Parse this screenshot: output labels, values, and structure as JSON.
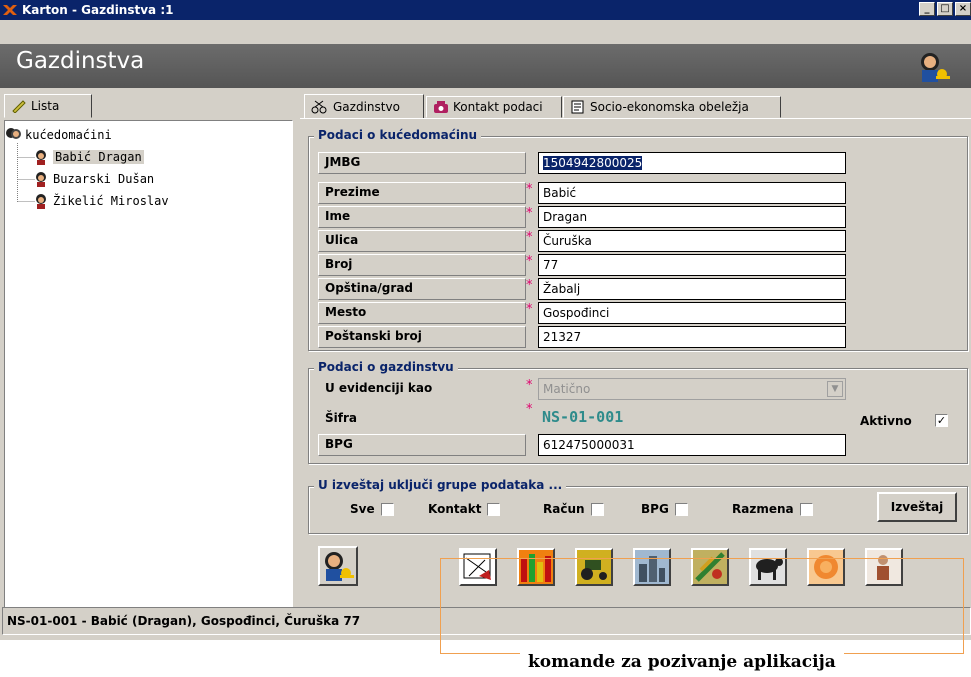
{
  "window": {
    "title": "Karton - Gazdinstva :1",
    "buttons": [
      "_",
      "□",
      "×"
    ]
  },
  "header": {
    "title": "Gazdinstva"
  },
  "left": {
    "tab_label": "Lista",
    "tree_root": "kućedomaćini",
    "tree_items": [
      "Babić Dragan",
      "Buzarski Dušan",
      "Žikelić Miroslav"
    ]
  },
  "tabs": [
    {
      "label": "Gazdinstvo",
      "icon": "scissors-icon"
    },
    {
      "label": "Kontakt podaci",
      "icon": "phone-icon"
    },
    {
      "label": "Socio-ekonomska obeležja",
      "icon": "document-icon"
    }
  ],
  "household": {
    "group_label": "Podaci o kućedomaćinu",
    "fields": [
      {
        "label": "JMBG",
        "value": "1504942800025",
        "required": false
      },
      {
        "label": "Prezime",
        "value": "Babić",
        "required": true
      },
      {
        "label": "Ime",
        "value": "Dragan",
        "required": true
      },
      {
        "label": "Ulica",
        "value": "Čuruška",
        "required": true
      },
      {
        "label": "Broj",
        "value": "77",
        "required": true
      },
      {
        "label": "Opština/grad",
        "value": "Žabalj",
        "required": true
      },
      {
        "label": "Mesto",
        "value": "Gospođinci",
        "required": true
      },
      {
        "label": "Poštanski broj",
        "value": "21327",
        "required": false
      }
    ]
  },
  "farm": {
    "group_label": "Podaci o gazdinstvu",
    "evidencija_label": "U evidenciji kao",
    "evidencija_value": "Matično",
    "sifra_label": "Šifra",
    "sifra_value": "NS-01-001",
    "aktivno_label": "Aktivno",
    "aktivno_checked": "✓",
    "bpg_label": "BPG",
    "bpg_value": "612475000031"
  },
  "report": {
    "group_label": "U izveštaj uključi grupe podataka ...",
    "options": [
      "Sve",
      "Kontakt",
      "Račun",
      "BPG",
      "Razmena"
    ],
    "button": "Izveštaj"
  },
  "app_buttons": [
    "map-icon",
    "chart-icon",
    "tractor-icon",
    "buildings-icon",
    "crops-icon",
    "cow-icon",
    "food-icon",
    "person-icon"
  ],
  "statusbar": {
    "text": "NS-01-001 - Babić (Dragan), Gospođinci, Čuruška 77"
  },
  "annotation": {
    "text": "komande za pozivanje aplikacija"
  },
  "colors": {
    "titlebar": "#0a246a",
    "face": "#d4d0c8",
    "group_label": "#0a246a",
    "required": "#e0006e",
    "sifra": "#2e8b8b"
  }
}
